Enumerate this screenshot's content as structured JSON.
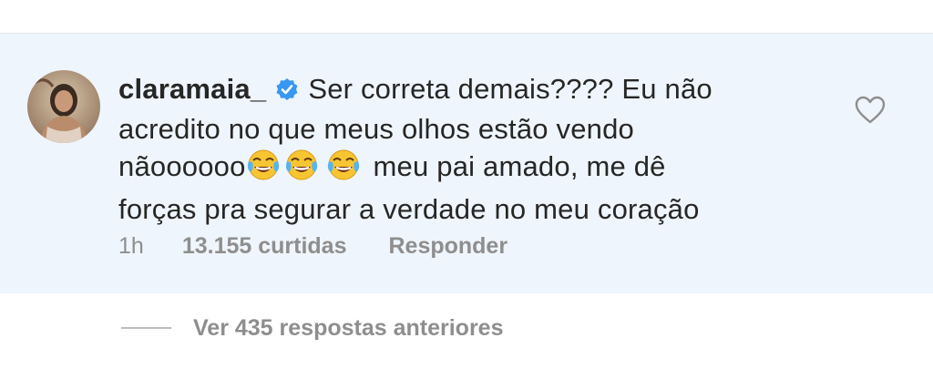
{
  "comment": {
    "username": "claramaia_",
    "verified": true,
    "lines": [
      "Ser correta demais???? Eu não",
      "acredito no que meus olhos estão vendo",
      "nãoooooo",
      "meu pai amado, me dê",
      "forças pra segurar a verdade no meu coração"
    ],
    "emoji_name": "face-with-tears-of-joy-icon"
  },
  "meta": {
    "time": "1h",
    "likes": "13.155 curtidas",
    "reply_label": "Responder"
  },
  "replies": {
    "view_label": "Ver 435 respostas anteriores"
  },
  "colors": {
    "card_bg": "#eff5fc",
    "verified_blue": "#3897f0",
    "meta_gray": "#8e8e8e",
    "text": "#262626"
  }
}
